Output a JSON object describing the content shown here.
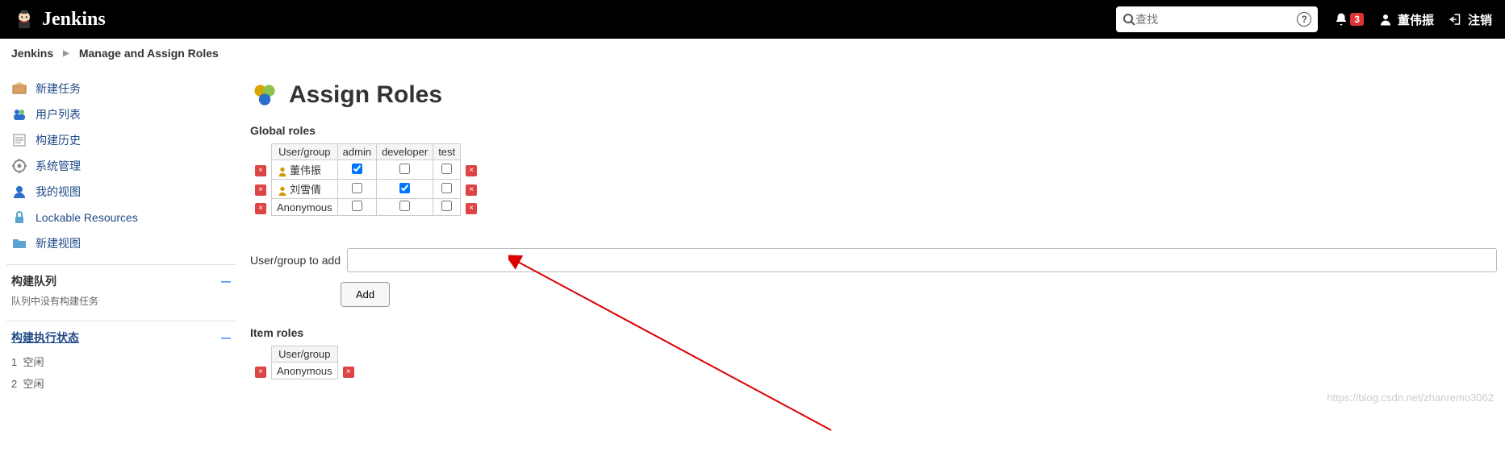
{
  "header": {
    "brand": "Jenkins",
    "search_placeholder": "查找",
    "notif_count": "3",
    "user_name": "董伟振",
    "logout_label": "注销"
  },
  "crumbs": {
    "root": "Jenkins",
    "page": "Manage and Assign Roles"
  },
  "sidebar": {
    "items": [
      {
        "label": "新建任务"
      },
      {
        "label": "用户列表"
      },
      {
        "label": "构建历史"
      },
      {
        "label": "系统管理"
      },
      {
        "label": "我的视图"
      },
      {
        "label": "Lockable Resources"
      },
      {
        "label": "新建视图"
      }
    ],
    "queue": {
      "title": "构建队列",
      "empty": "队列中没有构建任务"
    },
    "exec": {
      "title": "构建执行状态",
      "rows": [
        {
          "num": "1",
          "state": "空闲"
        },
        {
          "num": "2",
          "state": "空闲"
        }
      ]
    }
  },
  "page": {
    "title": "Assign Roles",
    "global_section": "Global roles",
    "item_section": "Item roles",
    "add_label": "User/group to add",
    "add_btn": "Add"
  },
  "global_table": {
    "headers": [
      "User/group",
      "admin",
      "developer",
      "test"
    ],
    "rows": [
      {
        "name": "董伟振",
        "icon": "person",
        "checks": [
          true,
          false,
          false
        ]
      },
      {
        "name": "刘雪倩",
        "icon": "person",
        "checks": [
          false,
          true,
          false
        ]
      },
      {
        "name": "Anonymous",
        "icon": "none",
        "checks": [
          false,
          false,
          false
        ]
      }
    ]
  },
  "item_table": {
    "headers": [
      "User/group"
    ],
    "rows": [
      {
        "name": "Anonymous"
      }
    ]
  },
  "watermark": "https://blog.csdn.net/zhanremo3062"
}
